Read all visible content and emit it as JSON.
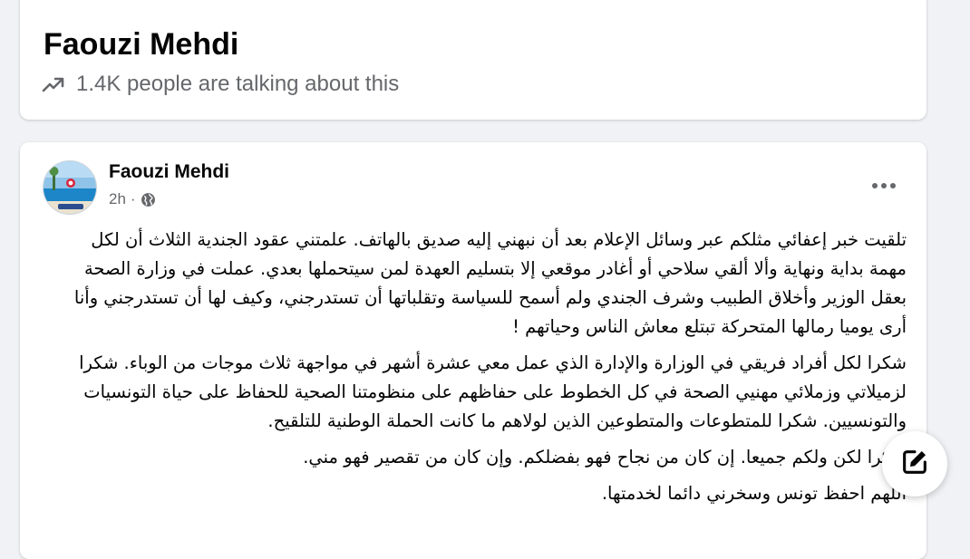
{
  "header": {
    "title": "Faouzi Mehdi",
    "talking_about": "1.4K people are talking about this",
    "trend_icon": "trending-up-icon"
  },
  "post": {
    "author": "Faouzi Mehdi",
    "time": "2h",
    "separator": "·",
    "audience_icon": "globe-icon",
    "more_icon": "more-options-icon",
    "paragraphs": [
      "تلقيت خبر إعفائي مثلكم عبر وسائل الإعلام بعد أن نبهني إليه صديق بالهاتف. علمتني عقود الجندية الثلاث أن لكل مهمة بداية ونهاية وألا ألقي سلاحي أو أغادر موقعي إلا بتسليم العهدة لمن سيتحملها بعدي. عملت في وزارة الصحة بعقل الوزير وأخلاق الطبيب وشرف الجندي ولم أسمح للسياسة وتقلباتها أن تستدرجني، وكيف لها أن تستدرجني وأنا أرى يوميا رمالها المتحركة تبتلع معاش الناس وحياتهم !",
      "شكرا لكل أفراد فريقي في الوزارة والإدارة الذي عمل معي عشرة أشهر في مواجهة ثلاث موجات من الوباء. شكرا لزميلاتي وزملائي مهنيي الصحة في كل الخطوط على حفاظهم على منظومتنا الصحية للحفاظ على حياة التونسيات والتونسيين. شكرا للمتطوعات والمتطوعين الذين لولاهم ما كانت الحملة الوطنية للتلقيح.",
      "شكرا لكن ولكم جميعا. إن كان من نجاح فهو بفضلكم. وإن كان من تقصير فهو مني.",
      "اللهم احفظ تونس وسخرني دائما لخدمتها."
    ]
  },
  "compose": {
    "icon": "compose-edit-icon"
  },
  "colors": {
    "background": "#f0f2f5",
    "card": "#ffffff",
    "primary_text": "#050505",
    "secondary_text": "#65676b"
  }
}
